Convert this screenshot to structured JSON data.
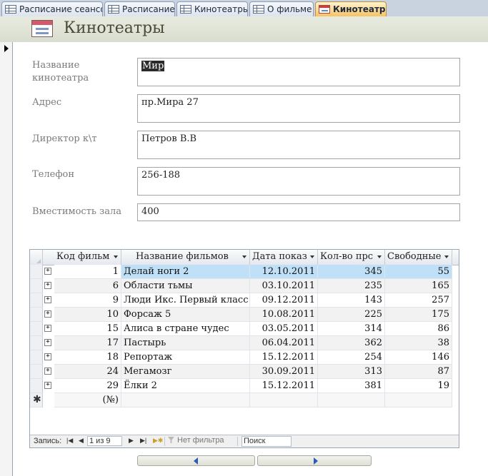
{
  "tabs": [
    {
      "label": "Расписание сеансов",
      "type": "table"
    },
    {
      "label": "Расписание",
      "type": "table"
    },
    {
      "label": "Кинотеатры",
      "type": "table"
    },
    {
      "label": "О фильме",
      "type": "table"
    },
    {
      "label": "Кинотеатры",
      "type": "form",
      "active": true
    }
  ],
  "form": {
    "title": "Кинотеатры",
    "fields": {
      "name_label": "Название кинотеатра",
      "name_value": "Мир",
      "address_label": "Адрес",
      "address_value": "пр.Мира 27",
      "director_label": "Директор к\\т",
      "director_value": "Петров В.В",
      "phone_label": "Телефон",
      "phone_value": "256-188",
      "capacity_label": "Вместимость зала",
      "capacity_value": "400"
    }
  },
  "subform": {
    "columns": [
      "Код фильм",
      "Название фильмов",
      "Дата показ",
      "Кол-во прс",
      "Свободные"
    ],
    "rows": [
      {
        "code": "1",
        "title": "Делай ноги 2",
        "date": "12.10.2011",
        "qty": "345",
        "free": "55"
      },
      {
        "code": "6",
        "title": "Области тьмы",
        "date": "03.10.2011",
        "qty": "235",
        "free": "165"
      },
      {
        "code": "9",
        "title": "Люди Икс. Первый класс",
        "date": "09.12.2011",
        "qty": "143",
        "free": "257"
      },
      {
        "code": "10",
        "title": "Форсаж 5",
        "date": "10.08.2011",
        "qty": "225",
        "free": "175"
      },
      {
        "code": "15",
        "title": "Алиса в стране чудес",
        "date": "03.05.2011",
        "qty": "314",
        "free": "86"
      },
      {
        "code": "17",
        "title": "Пастырь",
        "date": "06.04.2011",
        "qty": "362",
        "free": "38"
      },
      {
        "code": "18",
        "title": "Репортаж",
        "date": "15.12.2011",
        "qty": "254",
        "free": "146"
      },
      {
        "code": "24",
        "title": "Мегамозг",
        "date": "30.09.2011",
        "qty": "313",
        "free": "87"
      },
      {
        "code": "29",
        "title": "Ёлки 2",
        "date": "15.12.2011",
        "qty": "381",
        "free": "19"
      }
    ],
    "new_row_code": "(№)",
    "navigator": {
      "record_label": "Запись:",
      "record_counter": "1 из 9",
      "filter_label": "Нет фильтра",
      "search_placeholder": "Поиск"
    }
  },
  "colors": {
    "tab_active": "#f5c060",
    "header_bg": "#d9ddcf",
    "row_selected": "#bfe0f6",
    "nav_arrow": "#2e5bb8"
  }
}
